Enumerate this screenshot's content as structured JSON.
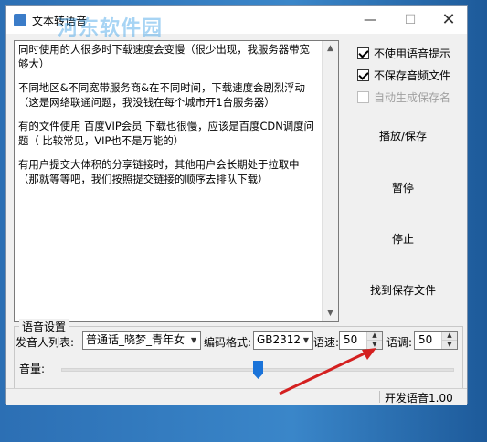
{
  "window": {
    "title": "文本转语音",
    "watermark": "河东软件园"
  },
  "textarea": {
    "paragraphs": [
      "同时使用的人很多时下载速度会变慢（很少出现，我服务器带宽够大）",
      "    不同地区&不同宽带服务商&在不同时间，下载速度会剧烈浮动（这是网络联通问题，我没钱在每个城市开1台服务器）",
      "    有的文件使用 百度VIP会员 下载也很慢，应该是百度CDN调度问题（ 比较常见，VIP也不是万能的）",
      "    有用户提交大体积的分享链接时，其他用户会长期处于拉取中（那就等等吧，我们按照提交链接的顺序去排队下载）"
    ]
  },
  "options": {
    "no_voice_prompt": {
      "label": "不使用语音提示",
      "checked": true
    },
    "no_save_audio": {
      "label": "不保存音频文件",
      "checked": true
    },
    "auto_save_name": {
      "label": "自动生成保存名",
      "checked": false,
      "disabled": true
    }
  },
  "buttons": {
    "play_save": "播放/保存",
    "pause": "暂停",
    "stop": "停止",
    "find_file": "找到保存文件"
  },
  "voice_settings": {
    "group_label": "语音设置",
    "speaker_label": "发音人列表:",
    "speaker_value": "普通话_晓梦_青年女",
    "encoding_label": "编码格式:",
    "encoding_value": "GB2312",
    "speed_label": "语速:",
    "speed_value": "50",
    "pitch_label": "语调:",
    "pitch_value": "50",
    "volume_label": "音量:",
    "volume_level_percent": 50
  },
  "status": {
    "text": "开发语音1.00"
  },
  "colors": {
    "accent": "#1a73d9",
    "arrow": "#d42020"
  }
}
